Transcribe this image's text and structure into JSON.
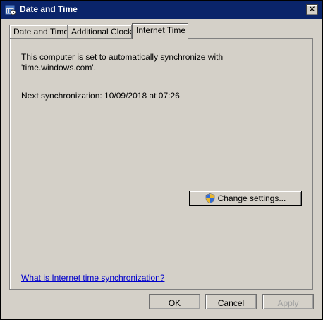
{
  "window": {
    "title": "Date and Time",
    "close_glyph": "✕"
  },
  "tabs": [
    {
      "label": "Date and Time",
      "active": false
    },
    {
      "label": "Additional Clocks",
      "active": false
    },
    {
      "label": "Internet Time",
      "active": true
    }
  ],
  "internet_time": {
    "sync_line1": "This computer is set to automatically synchronize with",
    "sync_line2": "'time.windows.com'.",
    "next_sync": "Next synchronization: 10/09/2018 at 07:26",
    "change_settings_label": "Change settings...",
    "help_link": "What is Internet time synchronization?"
  },
  "buttons": {
    "ok": "OK",
    "cancel": "Cancel",
    "apply": "Apply",
    "apply_enabled": false
  },
  "icons": {
    "title_icon": "calendar-clock-icon",
    "change_settings_icon": "uac-shield-icon"
  }
}
